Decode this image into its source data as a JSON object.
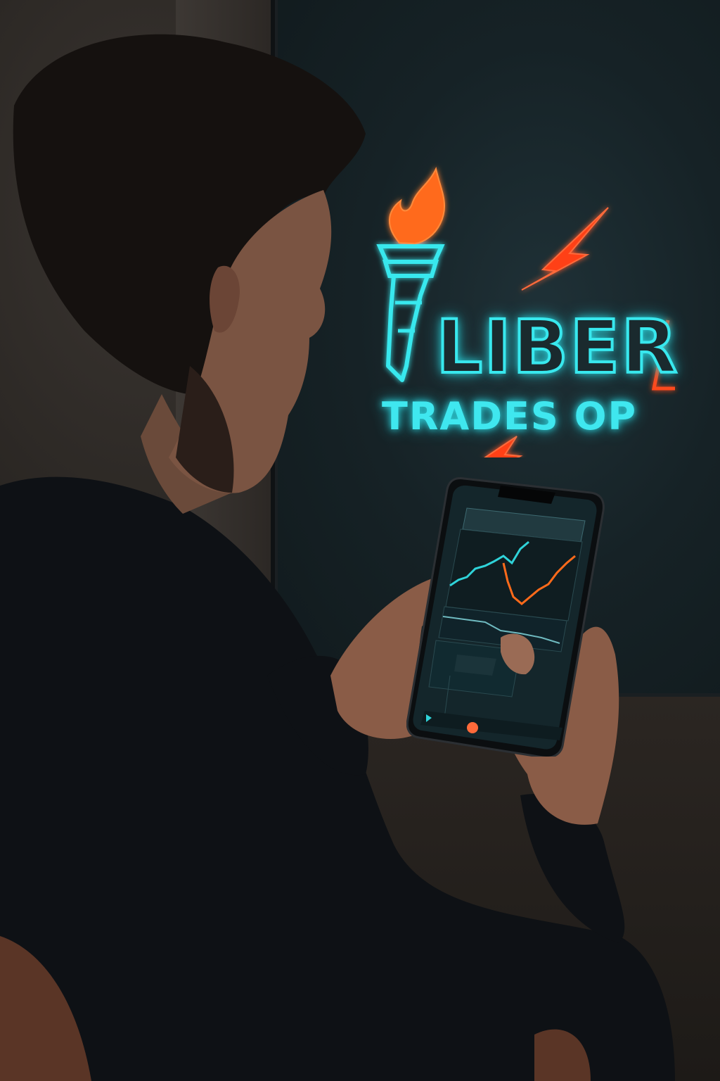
{
  "sign": {
    "title": "LIBER",
    "subtitle": "TRADES OP"
  },
  "colors": {
    "neon_cyan": "#38e8ee",
    "neon_orange": "#ff4a1f",
    "chart_up": "#2fd3d9",
    "chart_down": "#ff6a1a"
  },
  "icons": {
    "torch": "torch-icon",
    "bolt": "lightning-bolt-icon"
  }
}
